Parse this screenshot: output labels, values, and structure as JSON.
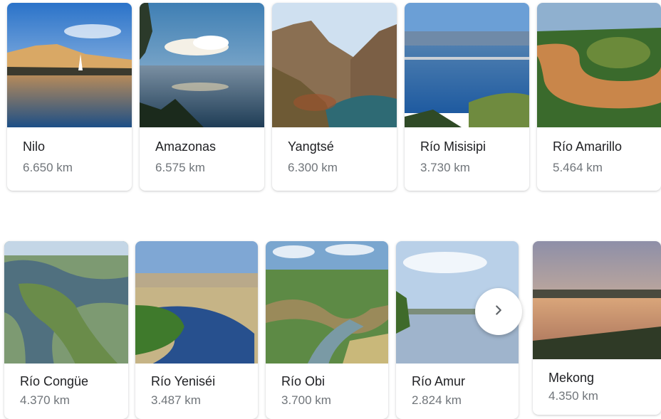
{
  "rivers_row1": [
    {
      "name": "Nilo",
      "length": "6.650 km"
    },
    {
      "name": "Amazonas",
      "length": "6.575 km"
    },
    {
      "name": "Yangtsé",
      "length": "6.300 km"
    },
    {
      "name": "Río Misisipi",
      "length": "3.730 km"
    },
    {
      "name": "Río Amarillo",
      "length": "5.464 km"
    }
  ],
  "rivers_row2": [
    {
      "name": "Río Congüe",
      "length": "4.370 km"
    },
    {
      "name": "Río Yeniséi",
      "length": "3.487 km"
    },
    {
      "name": "Río Obi",
      "length": "3.700 km"
    },
    {
      "name": "Río Amur",
      "length": "2.824 km"
    },
    {
      "name": "Mekong",
      "length": "4.350 km"
    }
  ],
  "next_button": {
    "icon": "chevron-right-icon"
  }
}
